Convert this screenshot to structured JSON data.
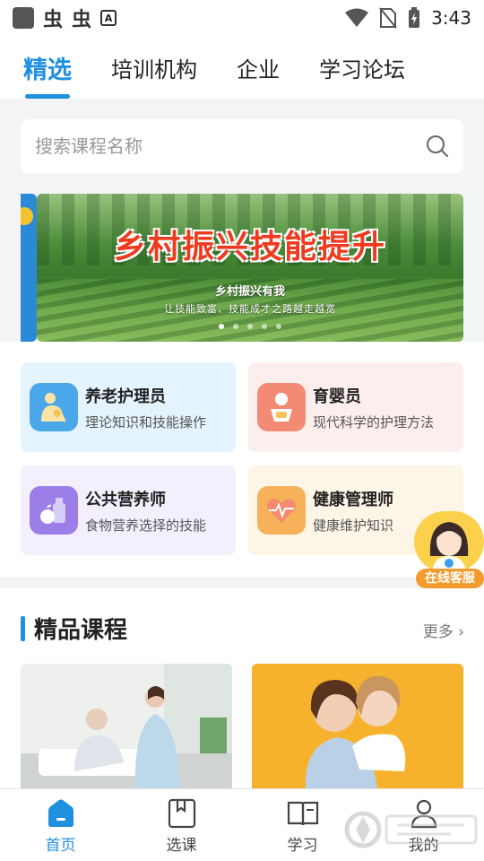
{
  "status_bar": {
    "time": "3:43",
    "left_glyphs": [
      "虫",
      "虫"
    ],
    "badge": "A"
  },
  "tabs": [
    {
      "label": "精选",
      "active": true
    },
    {
      "label": "培训机构",
      "active": false
    },
    {
      "label": "企业",
      "active": false
    },
    {
      "label": "学习论坛",
      "active": false
    }
  ],
  "search": {
    "placeholder": "搜索课程名称",
    "value": ""
  },
  "banner": {
    "title": "乡村振兴技能提升",
    "subtitle": "乡村振兴有我",
    "tagline": "让技能致富、技能成才之路越走越宽",
    "active_dot": 1,
    "dot_count": 5
  },
  "categories": [
    {
      "title": "养老护理员",
      "desc": "理论知识和技能操作",
      "icon": "elderly-care-icon",
      "bg": "#e4f3fd",
      "icon_bg": "#4aa8ea"
    },
    {
      "title": "育婴员",
      "desc": "现代科学的护理方法",
      "icon": "baby-icon",
      "bg": "#fdeeee",
      "icon_bg": "#f28a74"
    },
    {
      "title": "公共营养师",
      "desc": "食物营养选择的技能",
      "icon": "nutrition-icon",
      "bg": "#f3effd",
      "icon_bg": "#9b7ee8"
    },
    {
      "title": "健康管理师",
      "desc": "健康维护知识",
      "icon": "heart-pulse-icon",
      "bg": "#fdf5e6",
      "icon_bg": "#f6b15a"
    }
  ],
  "customer_service": {
    "label": "在线客服"
  },
  "featured": {
    "title": "精品课程",
    "more": "更多"
  },
  "bottom_nav": [
    {
      "label": "首页",
      "icon": "home-icon",
      "active": true
    },
    {
      "label": "选课",
      "icon": "book-bookmark-icon",
      "active": false
    },
    {
      "label": "学习",
      "icon": "open-book-icon",
      "active": false
    },
    {
      "label": "我的",
      "icon": "user-icon",
      "active": false
    }
  ],
  "colors": {
    "accent": "#1f8fe0",
    "banner_title": "#f03a1e",
    "cs_badge": "#f29a2e"
  }
}
